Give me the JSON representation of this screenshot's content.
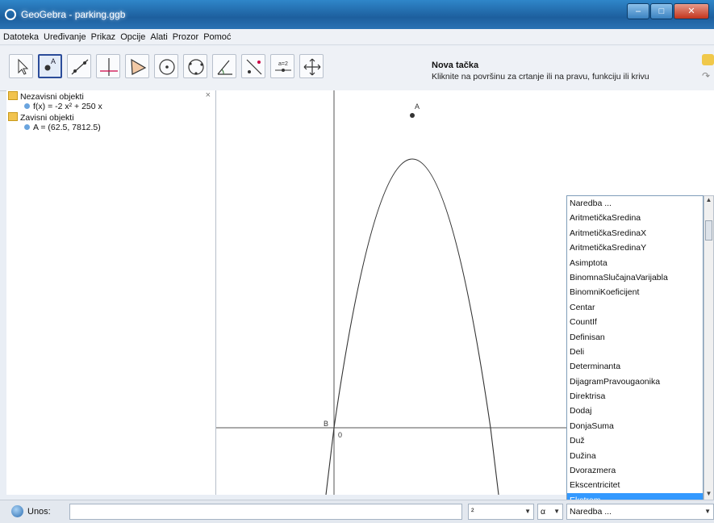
{
  "window": {
    "title": "GeoGebra - parking.ggb",
    "buttons": [
      "–",
      "□",
      "✕"
    ]
  },
  "menu": [
    "Datoteka",
    "Uređivanje",
    "Prikaz",
    "Opcije",
    "Alati",
    "Prozor",
    "Pomoć"
  ],
  "toolbar": {
    "tools": [
      "move",
      "point",
      "line",
      "perpendicular",
      "polygon",
      "circle",
      "conic",
      "angle",
      "reflect",
      "slider",
      "move-graphics"
    ],
    "active_tool": "point",
    "help_title": "Nova tačka",
    "help_text": "Kliknite na površinu za crtanje ili na pravu, funkciju ili krivu"
  },
  "algebra": {
    "close": "×",
    "free_header": "Nezavisni objekti",
    "free_items": [
      "f(x) = -2 x² + 250 x"
    ],
    "dependent_header": "Zavisni objekti",
    "dependent_items": [
      "A = (62.5, 7812.5)"
    ]
  },
  "graphics": {
    "point_A": "A",
    "point_B": "B",
    "point_origin": "0"
  },
  "commands": {
    "items": [
      "Naredba ...",
      "AritmetičkaSredina",
      "AritmetičkaSredinaX",
      "AritmetičkaSredinaY",
      "Asimptota",
      "BinomnaSlučajnaVarijabla",
      "BinomniKoeficijent",
      "Centar",
      "CountIf",
      "Definisan",
      "Deli",
      "Determinanta",
      "DijagramPravougaonika",
      "Direktrisa",
      "Dodaj",
      "DonjaSuma",
      "Duž",
      "Dužina",
      "Dvorazmera",
      "Ekscentricitet",
      "Ekstrem"
    ],
    "selected": 20
  },
  "inputbar": {
    "label": "Unos:",
    "value": "",
    "symbol_combo": "²",
    "greek_combo": "α",
    "command_combo": "Naredba ..."
  }
}
